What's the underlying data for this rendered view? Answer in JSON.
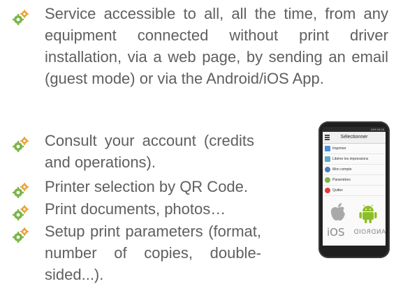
{
  "features": [
    {
      "icon": "gears-icon",
      "text": "Service accessible to all, all the time, from any equipment connected without print driver installation, via a web page, by sending an email (guest mode) or via the Android/iOS App."
    },
    {
      "icon": "gears-icon",
      "text": "Consult your account (credits and operations)."
    },
    {
      "icon": "gears-icon",
      "text": "Printer selection by QR Code."
    },
    {
      "icon": "gears-icon",
      "text": "Print documents, photos…"
    },
    {
      "icon": "gears-icon",
      "text": "Setup print parameters (format, number of copies, double-sided...)."
    }
  ],
  "colors": {
    "text": "#5f5f5f",
    "bullet_green": "#7ab648",
    "bullet_orange": "#e8a23a",
    "phone_body": "#1f1f1f",
    "android_green": "#8cbf26"
  },
  "phone": {
    "status": "24% 09:18",
    "title": "Sélectionner",
    "menu": [
      {
        "icon": "printer-icon",
        "label": "Imprimer",
        "color": "#4a90d9"
      },
      {
        "icon": "release-print-icon",
        "label": "Libérer les impressions",
        "color": "#5aa9c7"
      },
      {
        "icon": "account-icon",
        "label": "Mon compte",
        "color": "#4a7fb5"
      },
      {
        "icon": "settings-icon",
        "label": "Paramètres",
        "color": "#7ab648"
      },
      {
        "icon": "quit-icon",
        "label": "Quitter",
        "color": "#e03a3a"
      }
    ],
    "ios_label": "iOS",
    "android_label": "ANDROID"
  }
}
